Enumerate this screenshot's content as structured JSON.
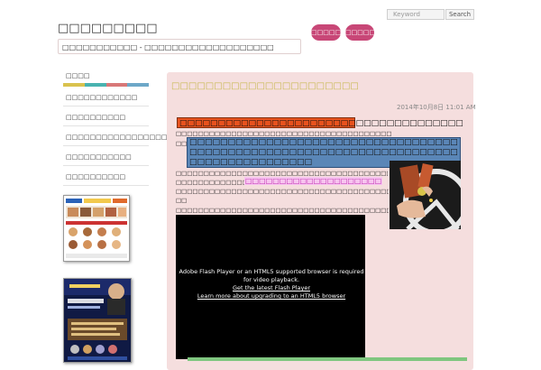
{
  "header": {
    "site_title": "□□□□□□□□□",
    "site_description": "□□□□□□□□□□□ - □□□□□□□□□□□□□□□□□□□",
    "nav": [
      {
        "label": "□□□□□"
      },
      {
        "label": "□□□□□"
      }
    ],
    "search": {
      "placeholder": "Keyword",
      "button_label": "Search"
    }
  },
  "sidebar": {
    "heading": "□□□□",
    "colorbar": [
      "#d9c24e",
      "#49b3b0",
      "#d87878",
      "#6da8c8"
    ],
    "items": [
      {
        "label": "□□□□□□□□□□□□"
      },
      {
        "label": "□□□□□□□□□□"
      },
      {
        "label": "□□□□□□□□□□□□□□□□□□"
      },
      {
        "label": "□□□□□□□□□□□"
      },
      {
        "label": "□□□□□□□□□□"
      }
    ]
  },
  "post": {
    "title": "□□□□□□□□□□□□□□□□□□□□□□",
    "date": "2014年10月8日 11:01 AM",
    "headline_orange": "□□□□□□□□□□□□□□□□□□□□□□□□□□□□□□□□□□□□□",
    "line1": "□□□□□□□□□□□□□□□□□□□□□□□□□□□□□□□□□□□□□□□",
    "line2_prefix": "□□□",
    "headline_blue": "□□□□□□□□□□□□□□□□□□□□□□□□□□□□□□□□□□□□□□□□□□□□□□□□□□□□□□□□□□□□□□□□□□□□□□□□□□□□□□□□□□□□□□",
    "line3": "□□□□□□□□□□□□□□□□□□□□□□□□□□□□□□□□□□□□□□□□□□□□□□□□□□□□□□□□",
    "line4_prefix": "□□□□□□□□□□□□□□□□□□",
    "pink_link": "□□□□□□□□□□□□□□□□□□□□",
    "line5": "□□□□□□□□□□□□□□□□□□□□□□□□□□□□□□□□□□□□□□□□□□□□□□□□□□□□□□□□□",
    "line5b": "□□",
    "line6": "□□□□□□□□□□□□□□□□□□□□□□□□□□□□□□□□□□□□□□□□□□□□□□□□"
  },
  "video": {
    "line1": "Adobe Flash Player or an HTML5 supported browser is required",
    "line2": "for video playback.",
    "link1": "Get the latest Flash Player",
    "link2": "Learn more about upgrading to an HTML5 browser"
  }
}
